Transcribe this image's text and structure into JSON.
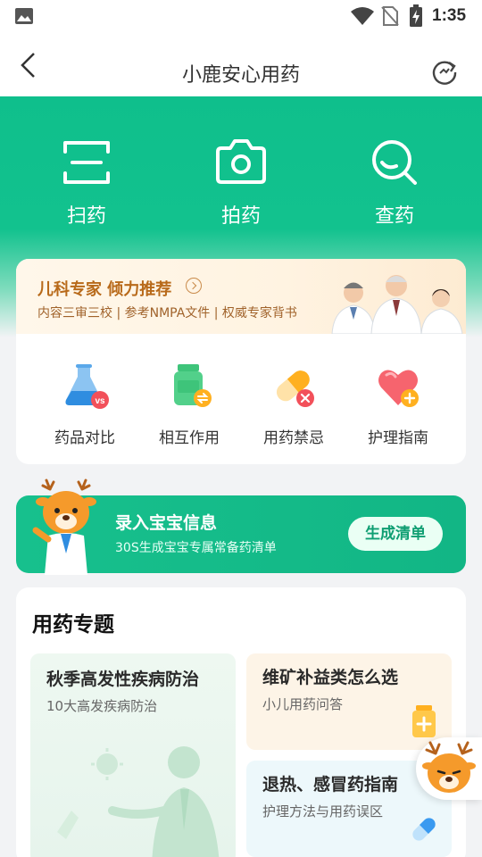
{
  "status_bar": {
    "time": "1:35"
  },
  "nav": {
    "title": "小鹿安心用药",
    "back_icon": "back-arrow-icon",
    "refresh_icon": "refresh-icon"
  },
  "hero": {
    "items": [
      {
        "label": "扫药",
        "icon": "scan-icon"
      },
      {
        "label": "拍药",
        "icon": "camera-icon"
      },
      {
        "label": "查药",
        "icon": "search-icon"
      }
    ]
  },
  "expert": {
    "headline": "儿科专家 倾力推荐",
    "subline": "内容三审三校 | 参考NMPA文件 | 权威专家背书"
  },
  "functions": [
    {
      "label": "药品对比",
      "icon": "flask-vs-icon"
    },
    {
      "label": "相互作用",
      "icon": "bottle-exchange-icon"
    },
    {
      "label": "用药禁忌",
      "icon": "pill-forbidden-icon"
    },
    {
      "label": "护理指南",
      "icon": "heart-plus-icon"
    }
  ],
  "baby": {
    "title": "录入宝宝信息",
    "subtitle": "30S生成宝宝专属常备药清单",
    "cta": "生成清单"
  },
  "topics": {
    "section_title": "用药专题",
    "items": [
      {
        "title": "秋季高发性疾病防治",
        "subtitle": "10大高发疾病防治"
      },
      {
        "title": "维矿补益类怎么选",
        "subtitle": "小儿用药问答"
      },
      {
        "title": "退热、感冒药指南",
        "subtitle": "护理方法与用药误区"
      }
    ]
  },
  "colors": {
    "primary": "#12c28e",
    "accent_orange": "#b86a1a"
  }
}
